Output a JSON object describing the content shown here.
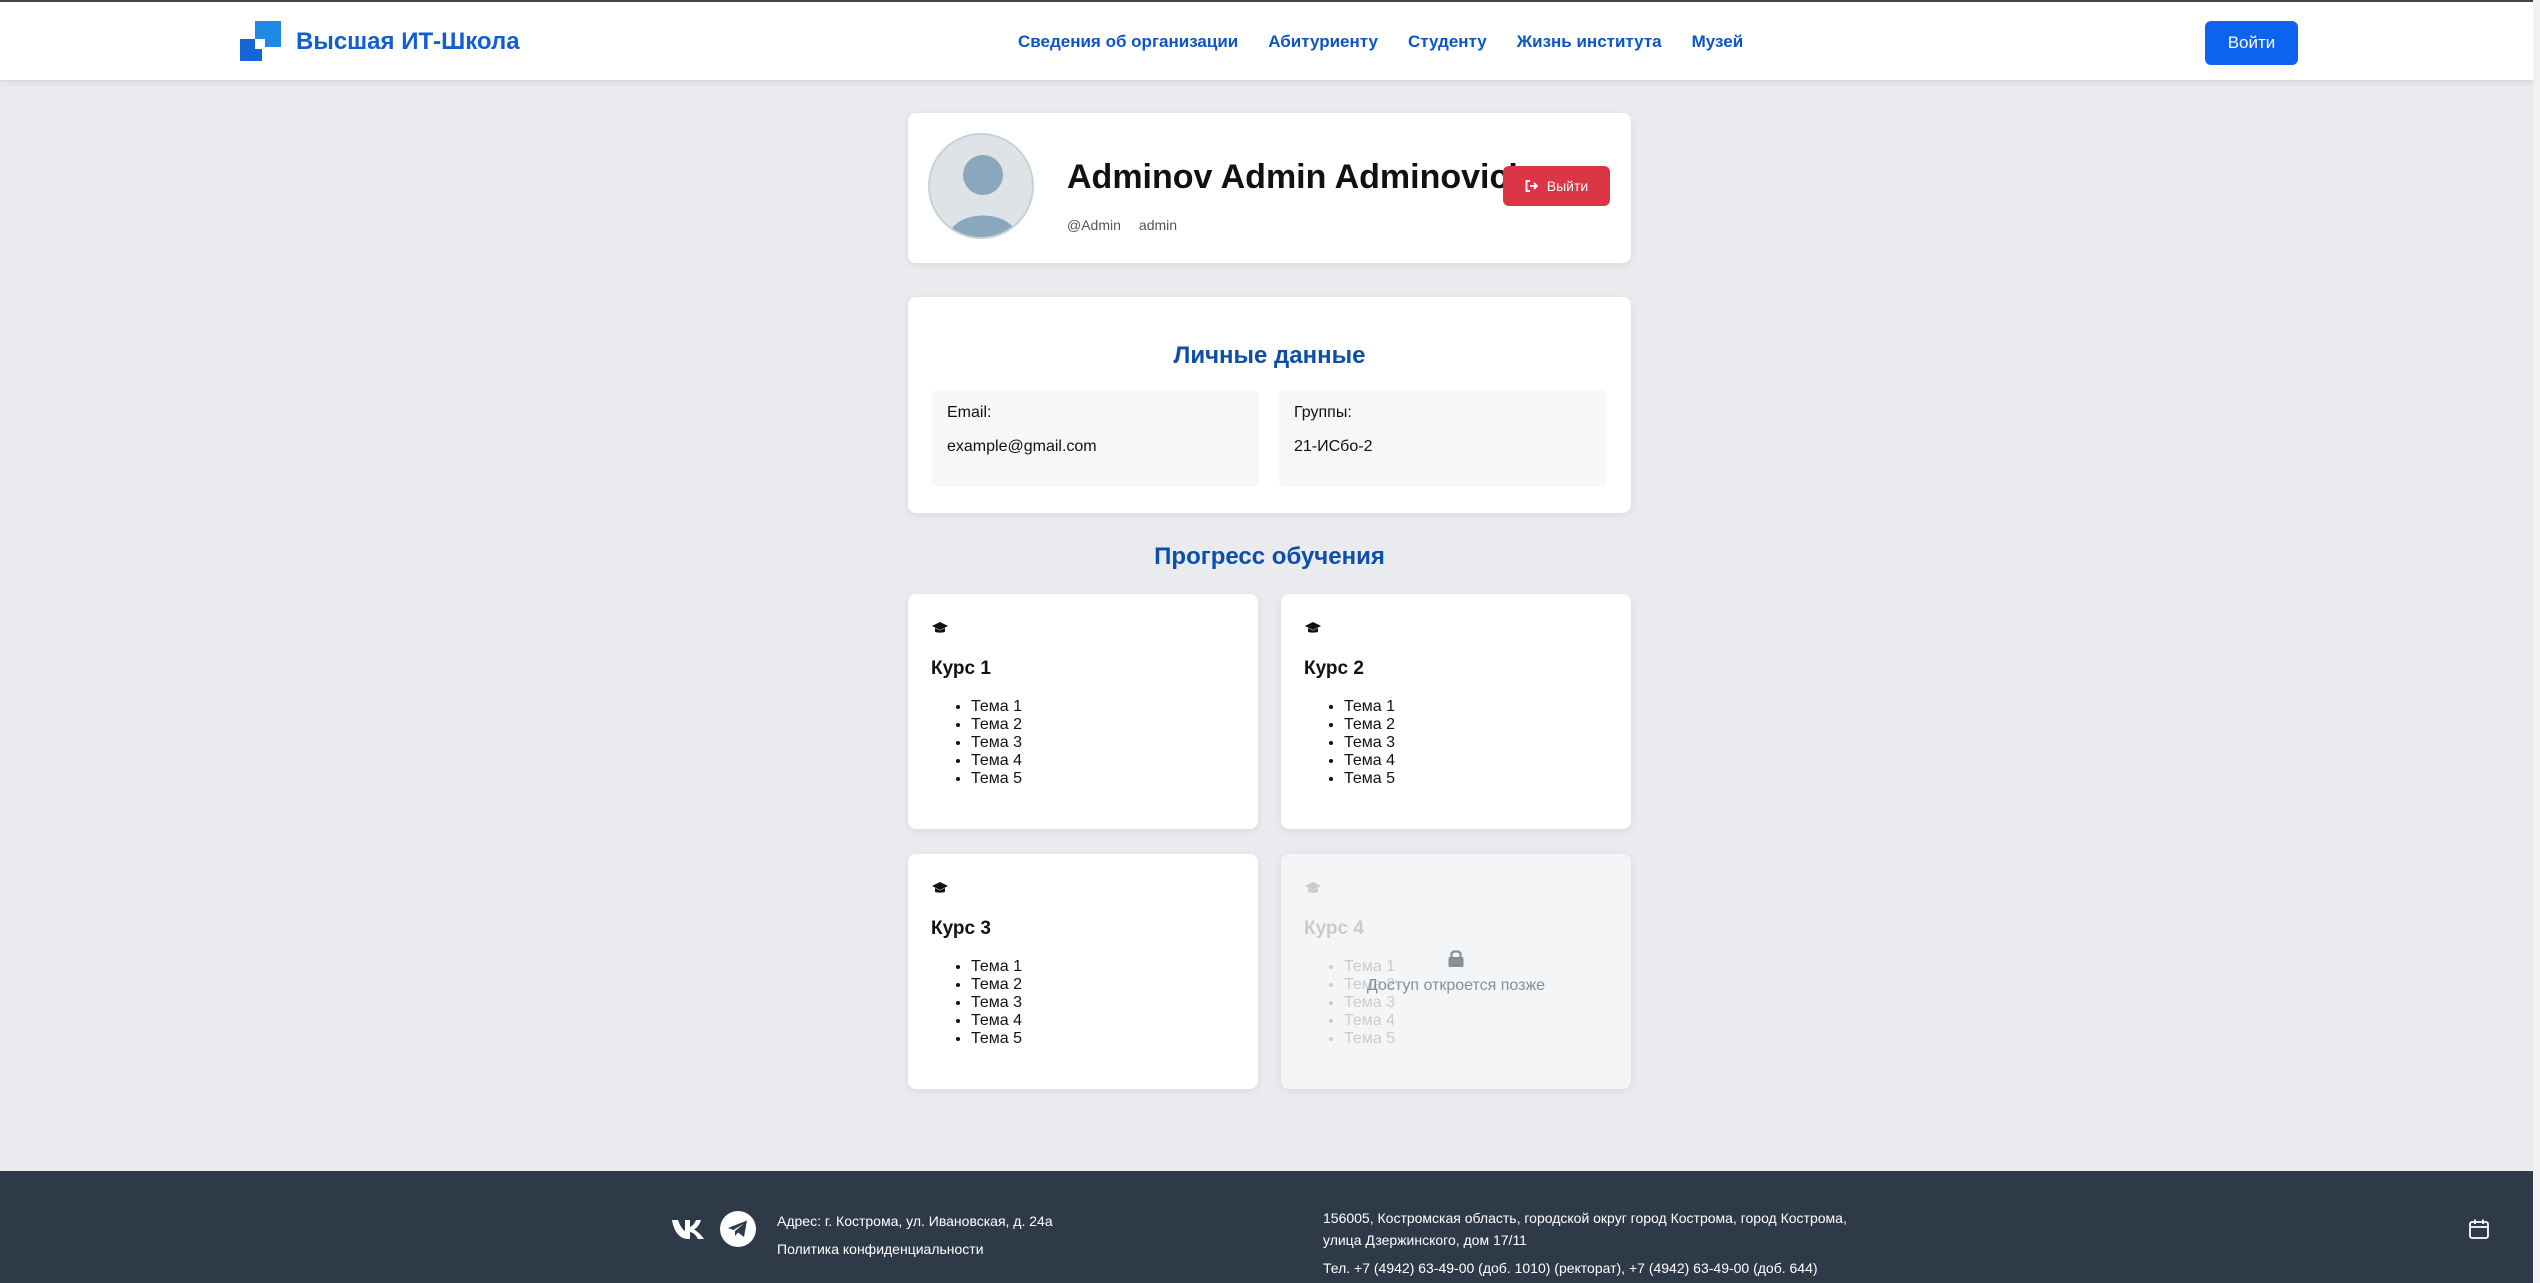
{
  "header": {
    "logo_text": "Высшая ИТ-Школа",
    "nav": [
      {
        "label": "Сведения об организации"
      },
      {
        "label": "Абитуриенту"
      },
      {
        "label": "Студенту"
      },
      {
        "label": "Жизнь института"
      },
      {
        "label": "Музей"
      }
    ],
    "login_label": "Войти"
  },
  "profile": {
    "full_name": "Adminov Admin Adminovich",
    "username": "@Admin",
    "role": "admin",
    "logout_label": "Выйти"
  },
  "personal": {
    "title": "Личные данные",
    "email_label": "Email:",
    "email_value": "example@gmail.com",
    "groups_label": "Группы:",
    "groups_value": "21-ИСбо-2"
  },
  "progress": {
    "title": "Прогресс обучения",
    "courses": [
      {
        "title": "Курс 1",
        "topics": [
          "Тема 1",
          "Тема 2",
          "Тема 3",
          "Тема 4",
          "Тема 5"
        ],
        "locked": false
      },
      {
        "title": "Курс 2",
        "topics": [
          "Тема 1",
          "Тема 2",
          "Тема 3",
          "Тема 4",
          "Тема 5"
        ],
        "locked": false
      },
      {
        "title": "Курс 3",
        "topics": [
          "Тема 1",
          "Тема 2",
          "Тема 3",
          "Тема 4",
          "Тема 5"
        ],
        "locked": false
      },
      {
        "title": "Курс 4",
        "topics": [
          "Тема 1",
          "Тема 2",
          "Тема 3",
          "Тема 4",
          "Тема 5"
        ],
        "locked": true
      }
    ],
    "locked_text": "Доступ откроется позже"
  },
  "footer": {
    "address": "Адрес: г. Кострома, ул. Ивановская, д. 24а",
    "privacy": "Политика конфиденциальности",
    "legal_address": "156005, Костромская область, городской округ город Кострома, город Кострома, улица Дзержинского, дом 17/11",
    "phone": "Тел. +7 (4942) 63-49-00 (доб. 1010) (ректорат), +7 (4942) 63-49-00 (доб. 644)"
  },
  "colors": {
    "brand": "#0d62f0",
    "heading_blue": "#0d4fa8",
    "danger": "#dc3545",
    "footer_bg": "#2e3a48"
  },
  "icons": [
    "logo-icon",
    "logout-icon",
    "graduation-cap-icon",
    "lock-icon",
    "vk-icon",
    "telegram-icon",
    "calendar-icon"
  ]
}
